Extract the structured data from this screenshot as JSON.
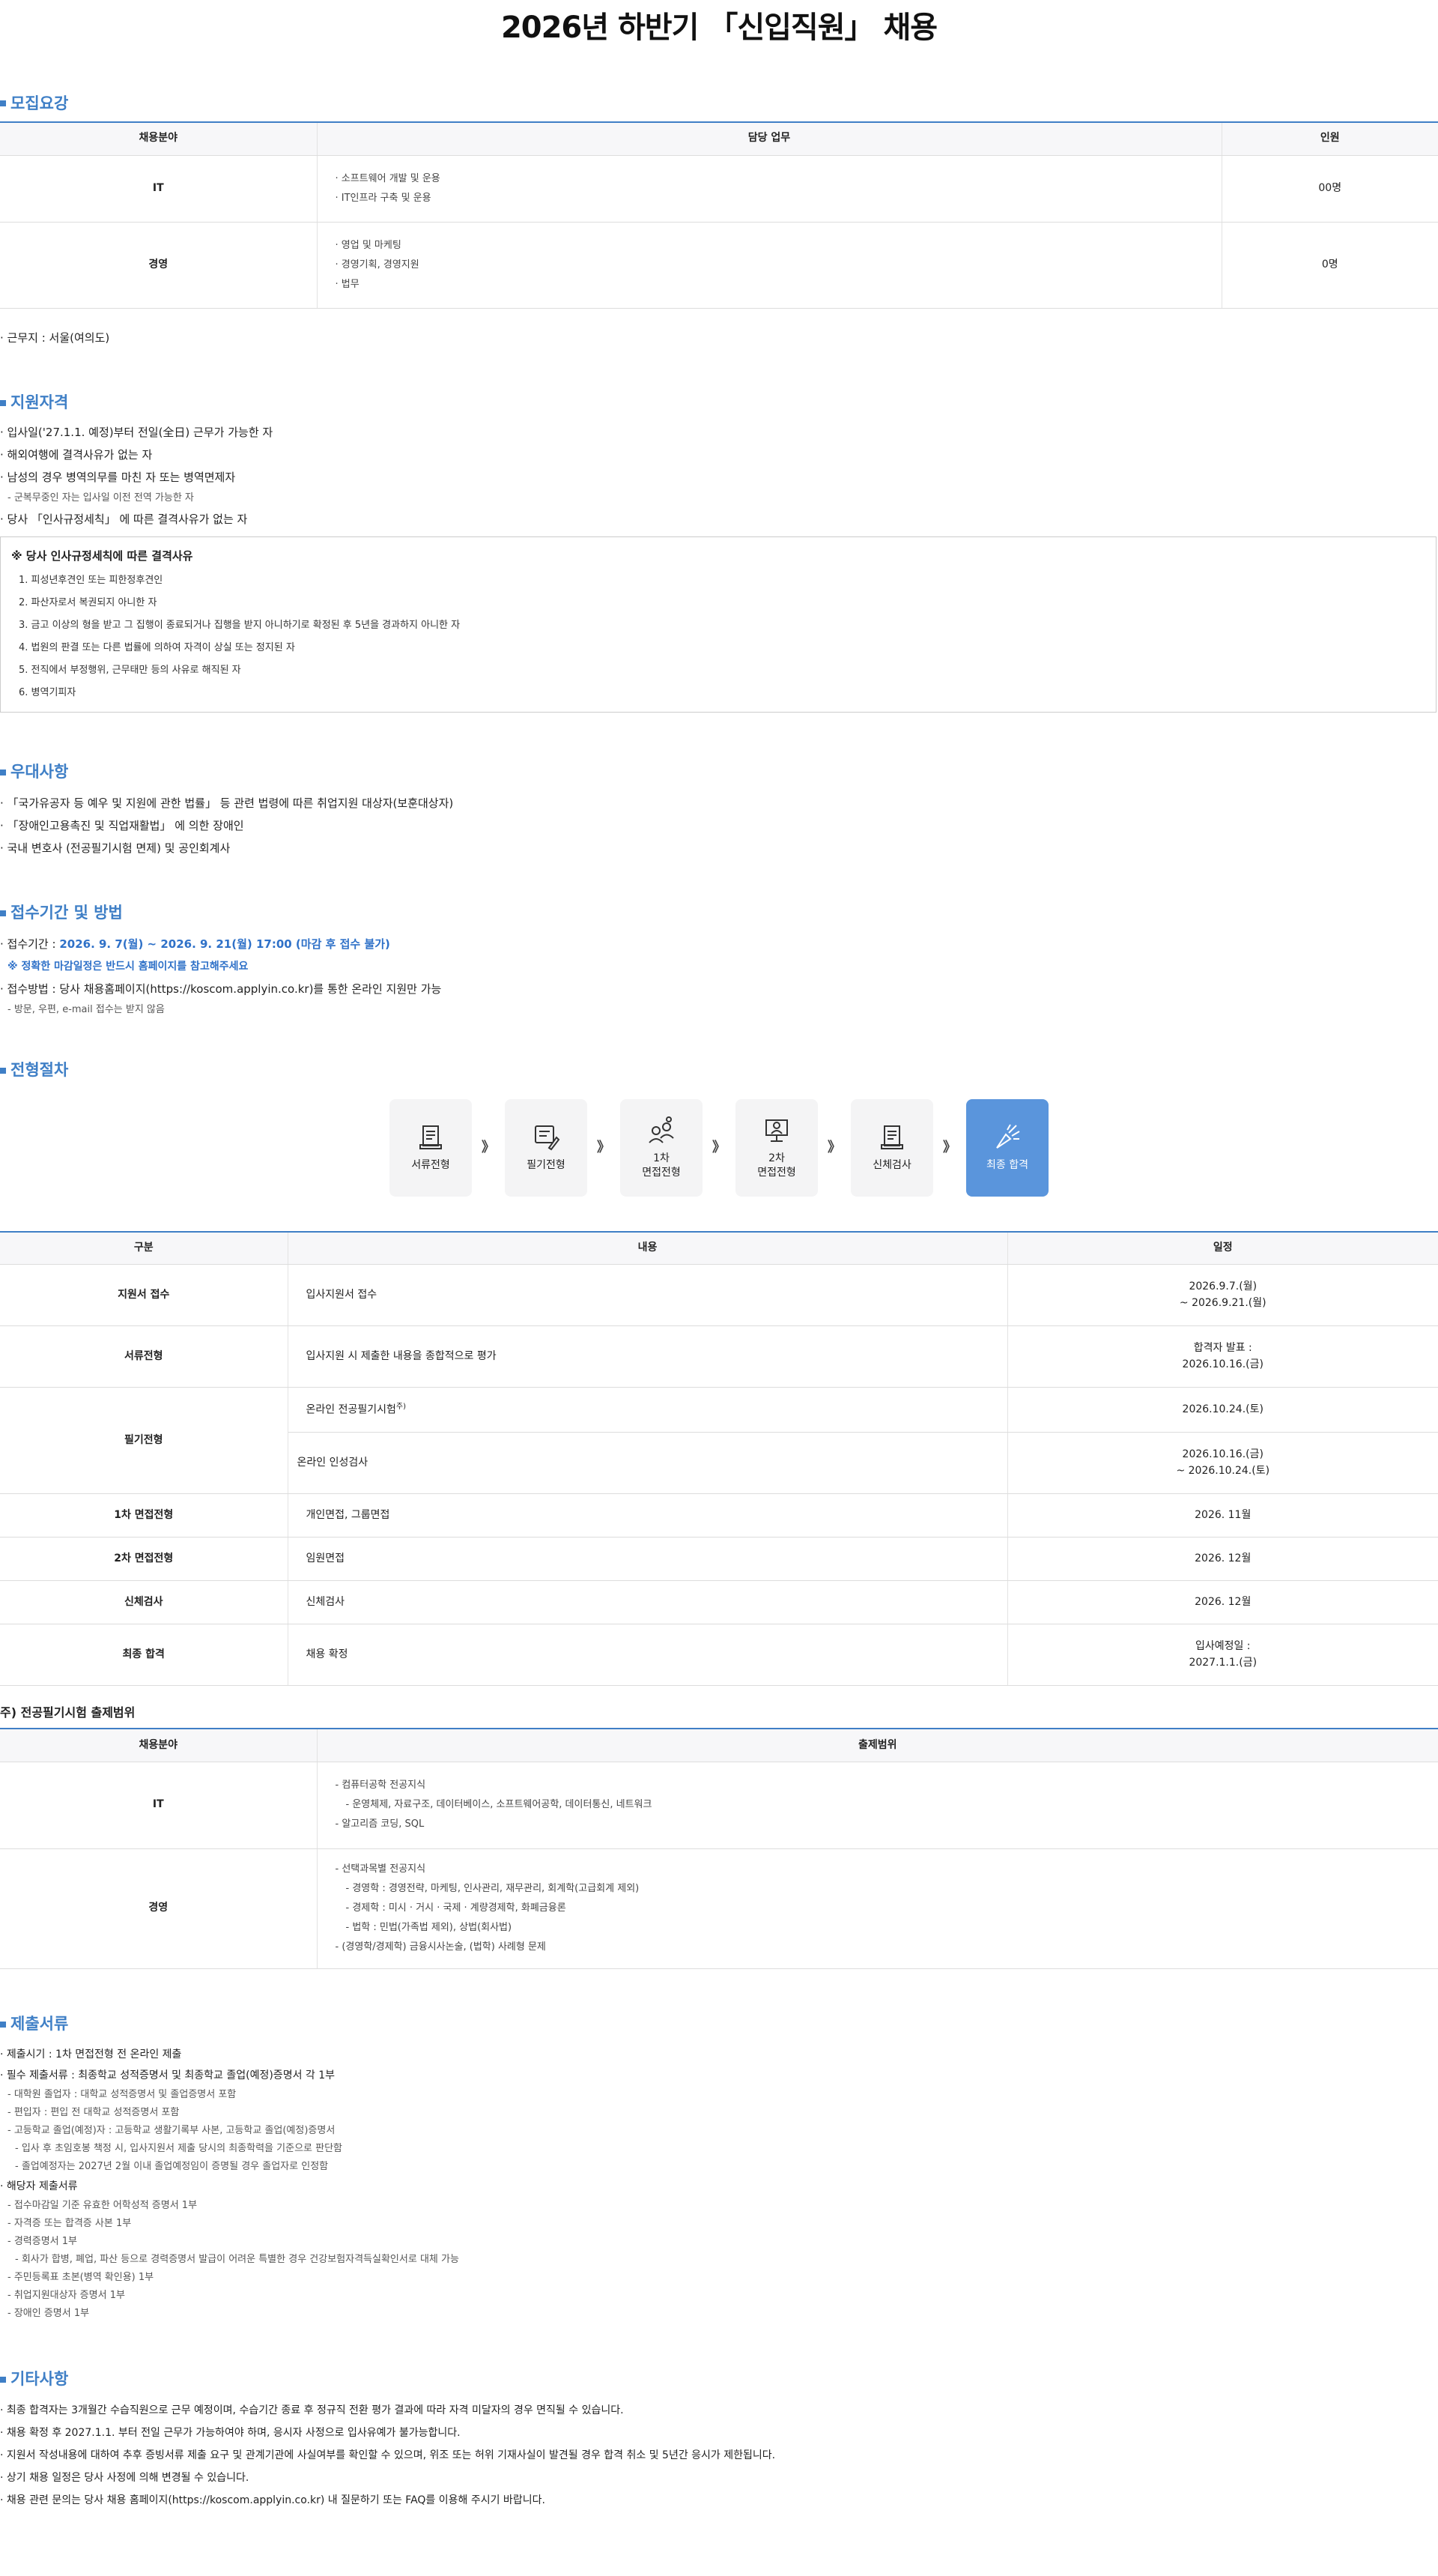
{
  "title": "2026년 하반기 「신입직원」 채용",
  "recruit": {
    "heading": "모집요강",
    "headers": [
      "채용분야",
      "담당 업무",
      "인원"
    ],
    "rows": [
      {
        "field": "IT",
        "duties": [
          "· 소프트웨어 개발 및 운용",
          "· IT인프라 구축 및 운용"
        ],
        "count": "00명"
      },
      {
        "field": "경영",
        "duties": [
          "· 영업 및 마케팅",
          "· 경영기획, 경영지원",
          "· 법무"
        ],
        "count": "0명"
      }
    ],
    "location": "· 근무지 : 서울(여의도)"
  },
  "qual": {
    "heading": "지원자격",
    "items": [
      "· 입사일('27.1.1. 예정)부터 전일(全日) 근무가 가능한 자",
      "· 해외여행에 결격사유가 없는 자",
      "· 남성의 경우 병역의무를 마친 자 또는 병역면제자"
    ],
    "sub": "- 군복무중인 자는 입사일 이전 전역 가능한 자",
    "last": "· 당사 「인사규정세칙」 에 따른 결격사유가 없는 자",
    "box_title": "※ 당사 인사규정세칙에 따른 결격사유",
    "box_items": [
      "1. 피성년후견인 또는 피한정후견인",
      "2. 파산자로서 복권되지 아니한 자",
      "3. 금고 이상의 형을 받고 그 집행이 종료되거나 집행을 받지 아니하기로 확정된 후 5년을 경과하지 아니한 자",
      "4. 법원의 판결 또는 다른 법률에 의하여 자격이 상실 또는 정지된 자",
      "5. 전직에서 부정행위, 근무태만 등의 사유로 해직된 자",
      "6. 병역기피자"
    ]
  },
  "pref": {
    "heading": "우대사항",
    "items": [
      "· 「국가유공자 등 예우 및 지원에 관한 법률」 등 관련 법령에 따른 취업지원 대상자(보훈대상자)",
      "· 「장애인고용촉진 및 직업재활법」 에 의한 장애인",
      "· 국내 변호사 (전공필기시험 면제) 및 공인회계사"
    ]
  },
  "apply": {
    "heading": "접수기간 및 방법",
    "period_label": "· 접수기간 : ",
    "period_value": "2026. 9. 7(월) ~ 2026. 9. 21(월) 17:00 (마감 후 접수 불가)",
    "note": "※ 정확한 마감일정은 반드시 홈페이지를 참고해주세요",
    "method": "· 접수방법 : 당사 채용홈페이지(https://koscom.applyin.co.kr)를 통한 온라인 지원만 가능",
    "method_sub": "- 방문, 우편, e-mail 접수는 받지 않음"
  },
  "process": {
    "heading": "전형절차",
    "steps": [
      {
        "label1": "서류전형",
        "label2": "",
        "icon": "document-icon"
      },
      {
        "label1": "필기전형",
        "label2": "",
        "icon": "written-test-icon"
      },
      {
        "label1": "1차",
        "label2": "면접전형",
        "icon": "group-interview-icon"
      },
      {
        "label1": "2차",
        "label2": "면접전형",
        "icon": "executive-interview-icon"
      },
      {
        "label1": "신체검사",
        "label2": "",
        "icon": "checkup-icon"
      },
      {
        "label1": "최종 합격",
        "label2": "",
        "icon": "celebration-icon"
      }
    ],
    "arrow": "》",
    "headers": [
      "구분",
      "내용",
      "일정"
    ],
    "rows": [
      {
        "stage": "지원서 접수",
        "content": "입사지원서 접수",
        "sched1": "2026.9.7.(월)",
        "sched2": "~ 2026.9.21.(월)"
      },
      {
        "stage": "서류전형",
        "content": "입사지원 시 제출한 내용을 종합적으로 평가",
        "sched1": "합격자 발표 :",
        "sched2": "2026.10.16.(금)"
      },
      {
        "stage": "필기전형",
        "content": "온라인 전공필기시험",
        "content_sup": "주)",
        "sched1": "2026.10.24.(토)",
        "sched2": ""
      },
      {
        "content": "온라인 인성검사",
        "sched1": "2026.10.16.(금)",
        "sched2": "~ 2026.10.24.(토)"
      },
      {
        "stage": "1차 면접전형",
        "content": "개인면접, 그룹면접",
        "sched1": "2026. 11월",
        "sched2": ""
      },
      {
        "stage": "2차 면접전형",
        "content": "임원면접",
        "sched1": "2026. 12월",
        "sched2": ""
      },
      {
        "stage": "신체검사",
        "content": "신체검사",
        "sched1": "2026. 12월",
        "sched2": ""
      },
      {
        "stage": "최종 합격",
        "content": "채용 확정",
        "sched1": "입사예정일 :",
        "sched2": "2027.1.1.(금)"
      }
    ]
  },
  "exam": {
    "heading": "주) 전공필기시험 출제범위",
    "headers": [
      "채용분야",
      "출제범위"
    ],
    "rows": [
      {
        "field": "IT",
        "lines": [
          "- 컴퓨터공학 전공지식",
          "   - 운영체제, 자료구조, 데이터베이스, 소프트웨어공학, 데이터통신, 네트워크",
          "- 알고리즘 코딩, SQL"
        ]
      },
      {
        "field": "경영",
        "lines": [
          "- 선택과목별 전공지식",
          "   - 경영학 : 경영전략, 마케팅, 인사관리, 재무관리, 회계학(고급회계 제외)",
          "   - 경제학 : 미시 · 거시 · 국제 · 계량경제학, 화폐금융론",
          "   - 법학 : 민법(가족법 제외), 상법(회사법)",
          "- (경영학/경제학) 금융시사논술, (법학) 사례형 문제"
        ]
      }
    ]
  },
  "docs": {
    "heading": "제출서류",
    "lines": [
      {
        "t": "· 제출시기 : 1차 면접전형 전 온라인 제출",
        "s": 0
      },
      {
        "t": "· 필수 제출서류 : 최종학교 성적증명서 및 최종학교 졸업(예정)증명서 각 1부",
        "s": 0
      },
      {
        "t": "- 대학원 졸업자 : 대학교 성적증명서 및 졸업증명서 포함",
        "s": 1
      },
      {
        "t": "- 편입자 : 편입 전 대학교 성적증명서 포함",
        "s": 1
      },
      {
        "t": "- 고등학교 졸업(예정)자 : 고등학교 생활기록부 사본, 고등학교 졸업(예정)증명서",
        "s": 1
      },
      {
        "t": "- 입사 후 초임호봉 책정 시, 입사지원서 제출 당시의 최종학력을 기준으로 판단함",
        "s": 2
      },
      {
        "t": "- 졸업예정자는 2027년 2월 이내 졸업예정임이 증명될 경우 졸업자로 인정함",
        "s": 2
      },
      {
        "t": "· 해당자 제출서류",
        "s": 0
      },
      {
        "t": "- 접수마감일 기준 유효한 어학성적 증명서 1부",
        "s": 1
      },
      {
        "t": "- 자격증 또는 합격증 사본 1부",
        "s": 1
      },
      {
        "t": "- 경력증명서 1부",
        "s": 1
      },
      {
        "t": "- 회사가 합병, 폐업, 파산 등으로 경력증명서 발급이 어려운 특별한 경우 건강보험자격득실확인서로 대체 가능",
        "s": 2
      },
      {
        "t": "- 주민등록표 초본(병역 확인용) 1부",
        "s": 1
      },
      {
        "t": "- 취업지원대상자 증명서 1부",
        "s": 1
      },
      {
        "t": "- 장애인 증명서 1부",
        "s": 1
      }
    ]
  },
  "etc": {
    "heading": "기타사항",
    "items": [
      "· 최종 합격자는 3개월간 수습직원으로 근무 예정이며, 수습기간 종료 후 정규직 전환 평가 결과에 따라 자격 미달자의 경우 면직될 수 있습니다.",
      "· 채용 확정 후 2027.1.1. 부터 전일 근무가 가능하여야 하며, 응시자 사정으로 입사유예가 불가능합니다.",
      "· 지원서 작성내용에 대하여 추후 증빙서류 제출 요구 및 관계기관에 사실여부를 확인할 수 있으며, 위조 또는 허위 기재사실이 발견될 경우 합격 취소 및 5년간 응시가 제한됩니다.",
      "· 상기 채용 일정은 당사 사정에 의해 변경될 수 있습니다.",
      "· 채용 관련 문의는 당사 채용 홈페이지(https://koscom.applyin.co.kr) 내 질문하기 또는 FAQ를 이용해 주시기 바랍니다."
    ]
  },
  "colors": {
    "accent": "#3f7fc6",
    "final_step": "#5a95dc"
  }
}
